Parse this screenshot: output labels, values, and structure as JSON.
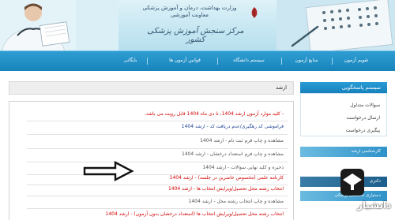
{
  "header": {
    "caption_line1": "وزارت بهداشت، درمان و آموزش پزشکی",
    "caption_line2": "معاونت آموزشی",
    "subtitle": "مرکز سنجش آموزش پزشکی کشور"
  },
  "nav": {
    "items": [
      "تقویم آزمون",
      "منابع آزمون",
      "سیستم دانشگاه",
      "قوانین آزمون ها",
      "بایگانی"
    ]
  },
  "main": {
    "title": "ارشد",
    "items": [
      {
        "text": "- کلیه موارد آزمون ارشد 1404، تا دی ماه 1404 قابل رویت می باشد.",
        "color": "#d40000"
      },
      {
        "text": "فراموشی کد رهگیری/عدم دریافت کد - ارشد 1404",
        "color": "#1b3f8f"
      },
      {
        "text": "مشاهده و چاپ فرم ثبت نام - ارشد 1404",
        "color": "#555555"
      },
      {
        "text": "مشاهده و چاپ فرم استعداد درخشان - ارشد 1404",
        "color": "#555555"
      },
      {
        "text": "ذخیره و کلید نهایی سوالات - ارشد 1404",
        "color": "#555555"
      },
      {
        "text": "کارنامه علمی (مخصوص حاضرین در جلسه) - ارشد 1404",
        "color": "#d40000"
      },
      {
        "text": "انتخاب رشته محل تحصیل/ویرایش انتخاب ها - ارشد 1404",
        "color": "#d40000"
      },
      {
        "text": "مشاهده و چاپ انتخاب رشته محل - ارشد 1404",
        "color": "#555555"
      },
      {
        "text": "انتخاب رشته محل تحصیل/ویرایش انتخاب ها (استعداد درخشان بدون آزمون) - ارشد 1404",
        "color": "#d40000"
      }
    ]
  },
  "sidebar": {
    "title": "سیستم پاسخگویی",
    "links": [
      "سوالات متداول",
      "ارسال درخواست",
      "پیگیری درخواست"
    ],
    "tiles": [
      "کارشناسی ارشد",
      "دکتری",
      "دستیاری تخصصی پزشکی"
    ]
  },
  "watermark": {
    "brand": "دانشیار",
    "site": "daneshyar"
  },
  "colors": {
    "nav": "#1f8ec8",
    "accent_red": "#d40000",
    "accent_blue": "#1b3f8f"
  }
}
